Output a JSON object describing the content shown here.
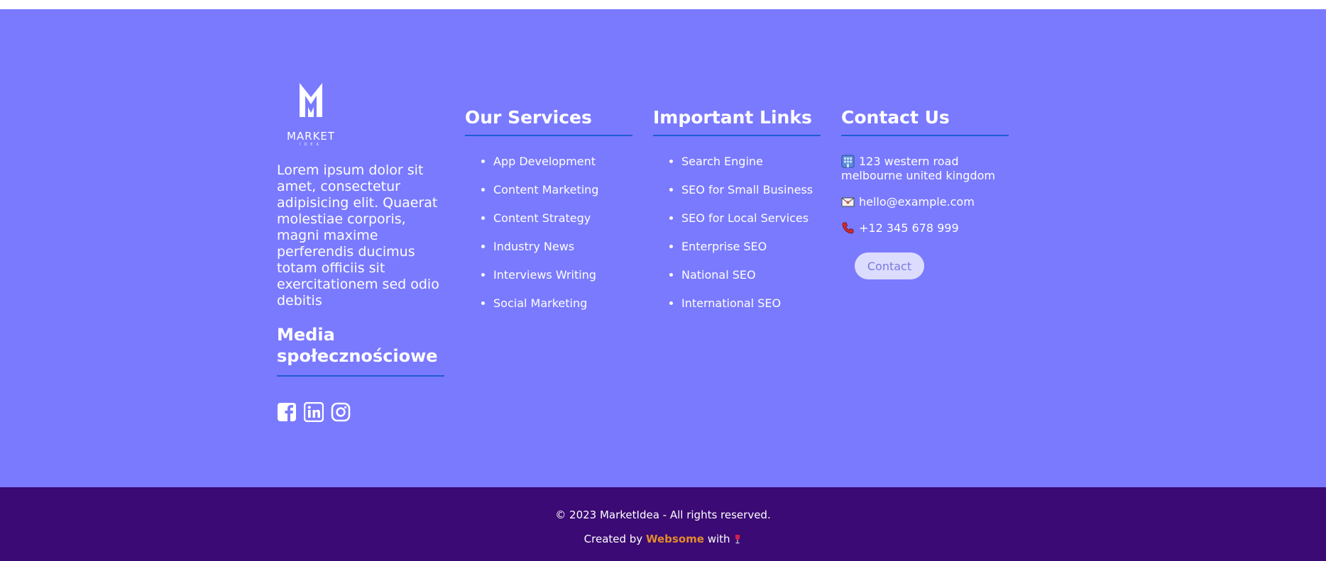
{
  "brand": {
    "logo_letter": "M",
    "logo_wordmark": "MARKET",
    "logo_tagline": "IDEA"
  },
  "about": {
    "text": "Lorem ipsum dolor sit amet, consectetur adipisicing elit. Quaerat molestiae corporis, magni maxime perferendis ducimus totam officiis sit exercitationem sed odio debitis"
  },
  "social": {
    "heading": "Media społecznościowe",
    "icons": [
      "facebook-icon",
      "linkedin-icon",
      "instagram-icon"
    ]
  },
  "services": {
    "heading": "Our Services",
    "items": [
      "App Development",
      "Content Marketing",
      "Content Strategy",
      "Industry News",
      "Interviews Writing",
      "Social Marketing"
    ]
  },
  "links": {
    "heading": "Important Links",
    "items": [
      "Search Engine",
      "SEO for Small Business",
      "SEO for Local Services",
      "Enterprise SEO",
      "National SEO",
      "International SEO"
    ]
  },
  "contact": {
    "heading": "Contact Us",
    "address_line1": "123 western road",
    "address_line2": "melbourne united kingdom",
    "email": "hello@example.com",
    "phone": "+12 345 678 999",
    "button_label": "Contact"
  },
  "footer": {
    "copyright": "© 2023 MarketIdea - All rights reserved.",
    "created_by": "Created by",
    "brand_name": "Websome",
    "with": "with"
  },
  "colors": {
    "footer_bg": "#7a7aff",
    "bottom_bar_bg": "#3b0a74",
    "accent_line": "#1f5cd6",
    "brand_link": "#e38b2c"
  }
}
